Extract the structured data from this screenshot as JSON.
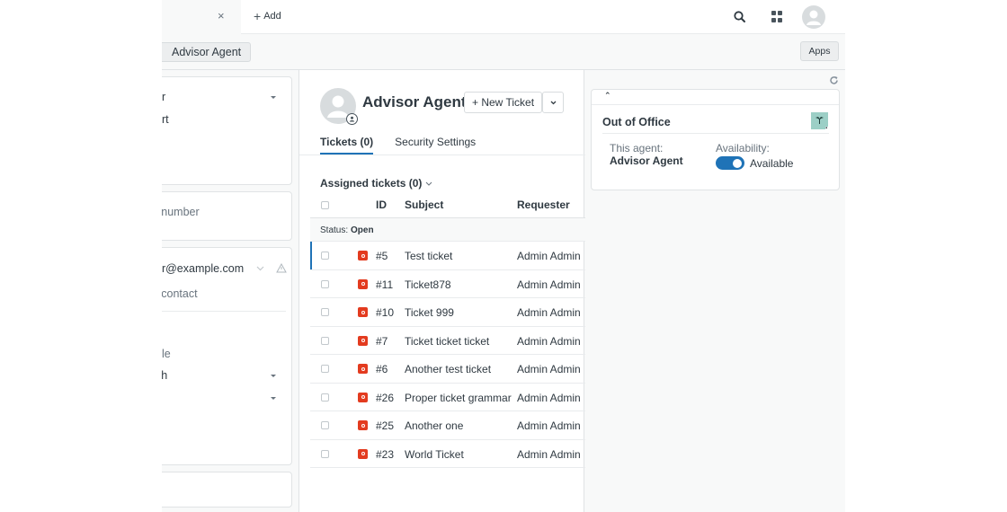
{
  "topbar": {
    "add_tab_label": "Add",
    "close_icon": "×",
    "icons": [
      "search-icon",
      "apps-grid-icon",
      "user-avatar-icon"
    ]
  },
  "subbar": {
    "user_tab_label": "Advisor Agent",
    "apps_button_label": "Apps"
  },
  "left_panel": {
    "role_value_partial": "or",
    "role_sub_partial": "ort",
    "phone_placeholder_partial": "l number",
    "email_partial": "or@example.com",
    "add_contact_partial": "l contact",
    "org_partial": "ple",
    "language_partial": "sh"
  },
  "profile": {
    "name": "Advisor Agent",
    "new_ticket_label": "+ New Ticket",
    "tabs": [
      {
        "label": "Tickets (0)",
        "active": true
      },
      {
        "label": "Security Settings",
        "active": false
      }
    ]
  },
  "tickets": {
    "section_label": "Assigned tickets (0)",
    "columns": [
      "ID",
      "Subject",
      "Requester"
    ],
    "status_group_prefix": "Status:",
    "status_group_value": "Open",
    "status_badge_letter": "O",
    "status_color": "#e33b1f",
    "rows": [
      {
        "id": "#5",
        "subject": "Test ticket",
        "requester": "Admin Admin",
        "selected": true
      },
      {
        "id": "#11",
        "subject": "Ticket878",
        "requester": "Admin Admin",
        "selected": false
      },
      {
        "id": "#10",
        "subject": "Ticket 999",
        "requester": "Admin Admin",
        "selected": false
      },
      {
        "id": "#7",
        "subject": "Ticket ticket ticket",
        "requester": "Admin Admin",
        "selected": false
      },
      {
        "id": "#6",
        "subject": "Another test ticket",
        "requester": "Admin Admin",
        "selected": false
      },
      {
        "id": "#26",
        "subject": "Proper ticket grammar",
        "requester": "Admin Admin",
        "selected": false
      },
      {
        "id": "#25",
        "subject": "Another one",
        "requester": "Admin Admin",
        "selected": false
      },
      {
        "id": "#23",
        "subject": "World Ticket",
        "requester": "Admin Admin",
        "selected": false
      }
    ]
  },
  "app_panel": {
    "title": "Out of Office",
    "agent_label": "This agent:",
    "agent_name": "Advisor Agent",
    "availability_label": "Availability:",
    "availability_value": "Available",
    "availability_on": true,
    "accent_color": "#1f73b7"
  }
}
